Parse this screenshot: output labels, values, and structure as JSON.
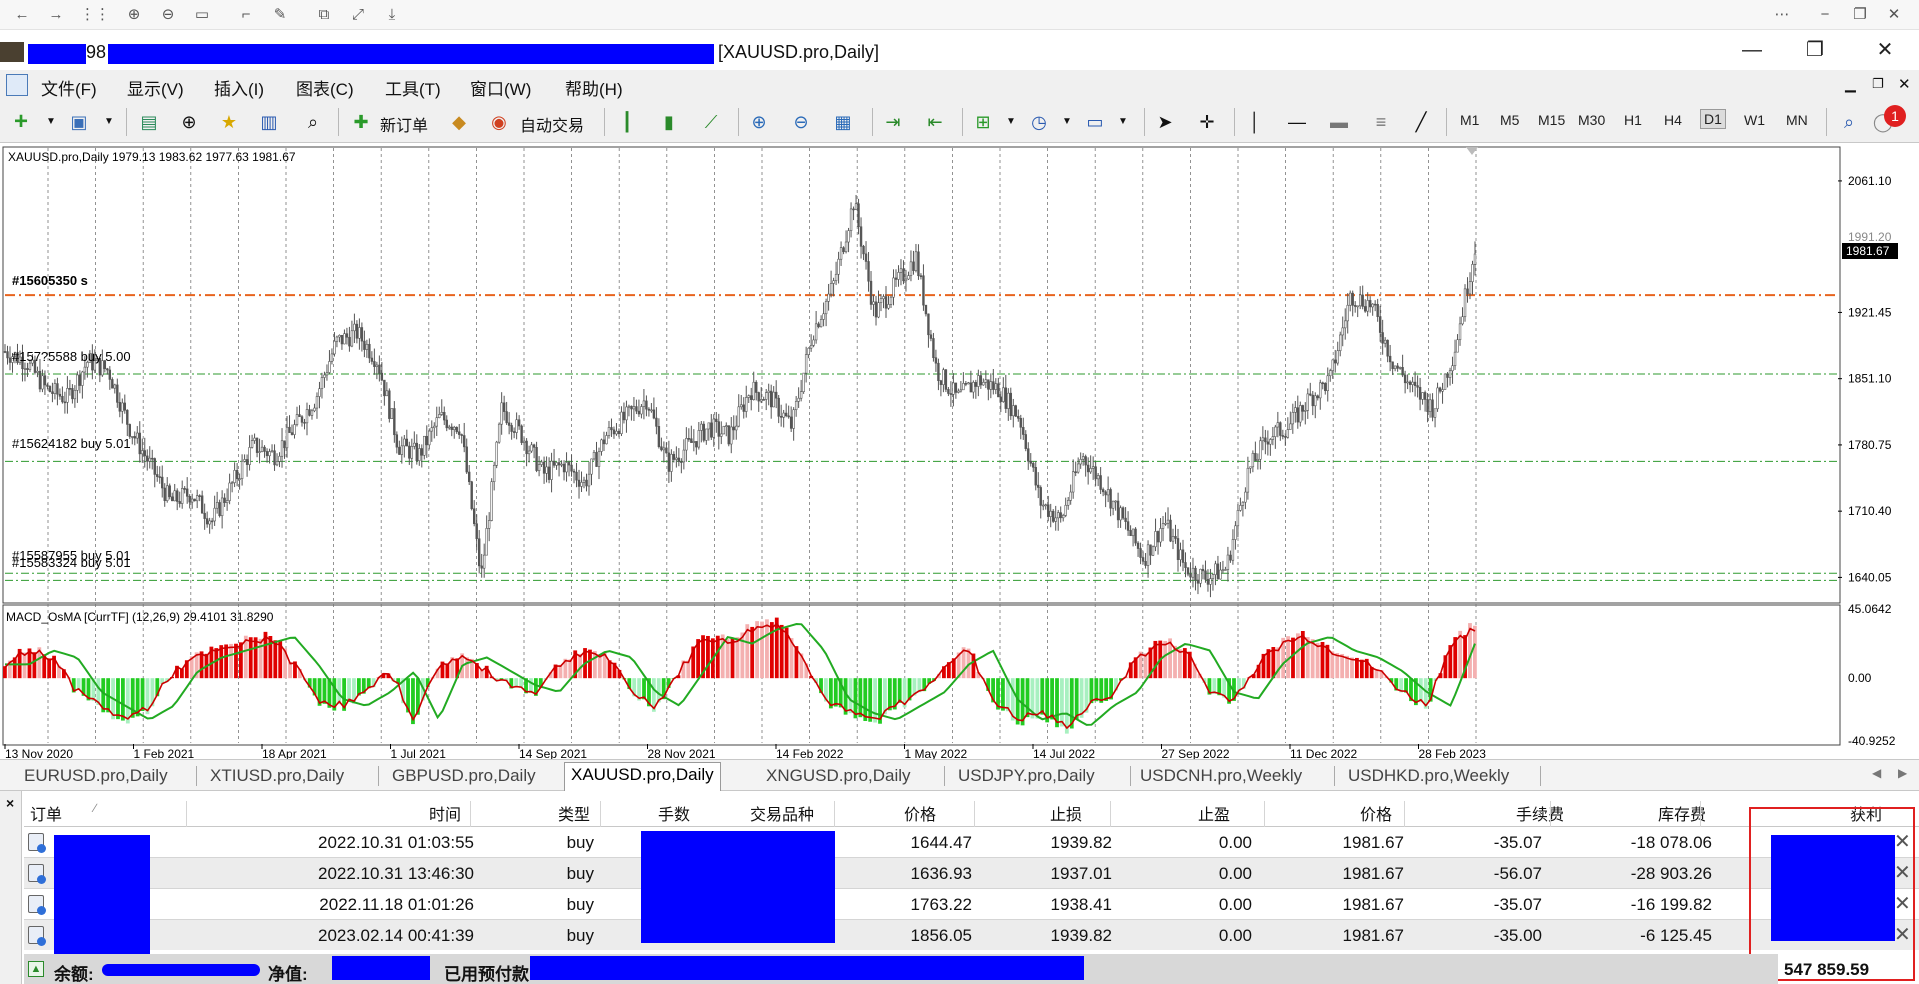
{
  "browser": {
    "icons": [
      "back-icon",
      "forward-icon",
      "grid-icon",
      "zoom-in-icon",
      "zoom-out-icon",
      "fit-icon",
      "crop-icon",
      "edit-icon",
      "copy-icon",
      "expand-icon",
      "download-icon",
      "more-icon",
      "minimize-icon",
      "restore-icon",
      "close-icon"
    ]
  },
  "window": {
    "title_prefix": "98",
    "title": "[XAUUSD.pro,Daily]"
  },
  "menu": [
    "文件(F)",
    "显示(V)",
    "插入(I)",
    "图表(C)",
    "工具(T)",
    "窗口(W)",
    "帮助(H)"
  ],
  "toolbar": {
    "new_order": "新订单",
    "auto_trading": "自动交易",
    "timeframes": [
      "M1",
      "M5",
      "M15",
      "M30",
      "H1",
      "H4",
      "D1",
      "W1",
      "MN"
    ],
    "active_timeframe": "D1",
    "notification_count": "1"
  },
  "chart": {
    "header": "XAUUSD.pro,Daily  1979.13 1983.62 1977.63 1981.67",
    "macd_header": "MACD_OsMA [CurrTF] (12,26,9) 29.4101 31.8290",
    "current_price": "1981.67",
    "partial_price_label": "1991.20",
    "price_ticks": [
      "2061.10",
      "1921.45",
      "1851.10",
      "1780.75",
      "1710.40",
      "1640.05"
    ],
    "macd_ticks": [
      "45.0642",
      "0.00",
      "-40.9252"
    ],
    "date_ticks": [
      "13 Nov 2020",
      "1 Feb 2021",
      "18 Apr 2021",
      "1 Jul 2021",
      "14 Sep 2021",
      "28 Nov 2021",
      "14 Feb 2022",
      "1 May 2022",
      "14 Jul 2022",
      "27 Sep 2022",
      "11 Dec 2022",
      "28 Feb 2023"
    ],
    "order_labels": {
      "sl_overlap": "#15605350 s",
      "buy1": "#157?5588 buy 5.00",
      "buy2": "#15624182 buy 5.01",
      "buy3": "#15587955 buy 5.01",
      "buy4": "#15583324 buy 5.01"
    },
    "colors": {
      "sl_line": "#e8641e",
      "entry_line": "#2e9a2e",
      "macd_up": "#e00000",
      "macd_down": "#22cc22",
      "signal_line": "#22aa22",
      "macd_line": "#cc0000"
    },
    "chart_data": {
      "type": "line",
      "title": "XAUUSD.pro,Daily",
      "xlabel": "",
      "ylabel": "",
      "ylim": [
        1615,
        2095
      ],
      "x_categories": [
        "13 Nov 2020",
        "1 Feb 2021",
        "18 Apr 2021",
        "1 Jul 2021",
        "14 Sep 2021",
        "28 Nov 2021",
        "14 Feb 2022",
        "1 May 2022",
        "14 Jul 2022",
        "27 Sep 2022",
        "11 Dec 2022",
        "28 Feb 2023"
      ],
      "close_series": [
        1880,
        1870,
        1840,
        1830,
        1870,
        1860,
        1800,
        1760,
        1720,
        1730,
        1700,
        1740,
        1780,
        1770,
        1800,
        1830,
        1890,
        1900,
        1870,
        1780,
        1770,
        1810,
        1800,
        1640,
        1820,
        1790,
        1750,
        1760,
        1740,
        1790,
        1810,
        1830,
        1760,
        1780,
        1800,
        1790,
        1840,
        1830,
        1800,
        1900,
        1950,
        2040,
        1920,
        1950,
        1980,
        1860,
        1830,
        1850,
        1840,
        1810,
        1720,
        1700,
        1770,
        1740,
        1700,
        1660,
        1700,
        1650,
        1640,
        1650,
        1750,
        1790,
        1800,
        1830,
        1850,
        1940,
        1930,
        1870,
        1840,
        1820,
        1880,
        1991
      ],
      "levels": [
        {
          "label": "#15605350 s",
          "value": 1939.8
        },
        {
          "label": "#157?5588 buy 5.00",
          "value": 1856.05
        },
        {
          "label": "#15624182 buy 5.01",
          "value": 1763.22
        },
        {
          "label": "#15587955 buy 5.01",
          "value": 1644.47
        },
        {
          "label": "#15583324 buy 5.01",
          "value": 1636.93
        }
      ],
      "macd": {
        "ylim": [
          -40.9252,
          45.0642
        ],
        "histogram": [
          10,
          20,
          15,
          -10,
          -20,
          -30,
          -20,
          5,
          15,
          20,
          25,
          30,
          10,
          -15,
          -20,
          -10,
          5,
          -30,
          10,
          15,
          5,
          -5,
          -10,
          10,
          20,
          15,
          -10,
          -20,
          5,
          30,
          25,
          35,
          40,
          20,
          -15,
          -25,
          -30,
          -20,
          -10,
          10,
          20,
          -15,
          -30,
          -25,
          -35,
          -20,
          -10,
          15,
          25,
          20,
          -10,
          -15,
          10,
          25,
          30,
          20,
          15,
          5,
          -10,
          -20,
          25,
          35
        ],
        "current_main": 29.4101,
        "current_signal": 31.829
      }
    }
  },
  "symbol_tabs": [
    "EURUSD.pro,Daily",
    "XTIUSD.pro,Daily",
    "GBPUSD.pro,Daily",
    "XAUUSD.pro,Daily",
    "XNGUSD.pro,Daily",
    "USDJPY.pro,Daily",
    "USDCNH.pro,Weekly",
    "USDHKD.pro,Weekly"
  ],
  "active_symbol_tab": "XAUUSD.pro,Daily",
  "terminal": {
    "headers": {
      "order": "订单",
      "time": "时间",
      "type": "类型",
      "lots": "手数",
      "symbol": "交易品种",
      "price": "价格",
      "sl": "止损",
      "tp": "止盈",
      "current": "价格",
      "commission": "手续费",
      "swap": "库存费",
      "profit": "获利"
    },
    "rows": [
      {
        "time": "2022.10.31 01:03:55",
        "type": "buy",
        "price": "1644.47",
        "sl": "1939.82",
        "tp": "0.00",
        "current": "1981.67",
        "commission": "-35.07",
        "swap": "-18 078.06"
      },
      {
        "time": "2022.10.31 13:46:30",
        "type": "buy",
        "price": "1636.93",
        "sl": "1937.01",
        "tp": "0.00",
        "current": "1981.67",
        "commission": "-56.07",
        "swap": "-28 903.26"
      },
      {
        "time": "2022.11.18 01:01:26",
        "type": "buy",
        "price": "1763.22",
        "sl": "1938.41",
        "tp": "0.00",
        "current": "1981.67",
        "commission": "-35.07",
        "swap": "-16 199.82"
      },
      {
        "time": "2023.02.14 00:41:39",
        "type": "buy",
        "price": "1856.05",
        "sl": "1939.82",
        "tp": "0.00",
        "current": "1981.67",
        "commission": "-35.00",
        "swap": "-6 125.45"
      }
    ],
    "status": {
      "balance_label": "余额:",
      "equity_label": "净值:",
      "margin_label": "已用预付款",
      "total_profit": "547 859.59"
    }
  }
}
